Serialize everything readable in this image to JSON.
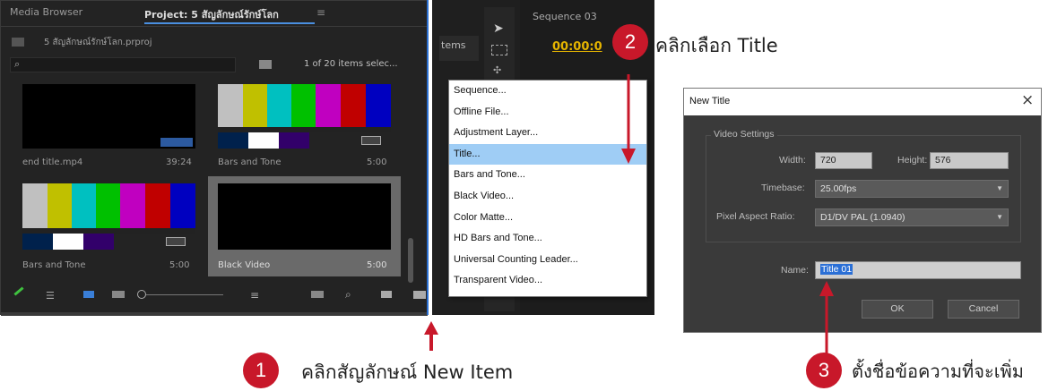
{
  "project_panel": {
    "tab_media_browser": "Media Browser",
    "tab_project": "Project: 5 สัญลักษณ์รักษ์โลก",
    "tab_menu_icon": "hamburger-icon",
    "project_file": "5 สัญลักษณ์รักษ์โลก.prproj",
    "search_icon": "search-icon",
    "items_status": "1 of 20 items selec...",
    "clips": [
      {
        "name": "end title.mp4",
        "duration": "39:24"
      },
      {
        "name": "Bars and Tone",
        "duration": "5:00"
      },
      {
        "name": "Bars and Tone",
        "duration": "5:00"
      },
      {
        "name": "Black Video",
        "duration": "5:00"
      }
    ]
  },
  "middle_panel": {
    "items_label": "tems",
    "sequence_tab": "Sequence 03",
    "timecode": "00:00:0"
  },
  "new_item_menu": {
    "items": [
      "Sequence...",
      "Offline File...",
      "Adjustment Layer...",
      "Title...",
      "Bars and Tone...",
      "Black Video...",
      "Color Matte...",
      "HD Bars and Tone...",
      "Universal Counting Leader...",
      "Transparent Video..."
    ],
    "selected": "Title..."
  },
  "dialog": {
    "title": "New Title",
    "close": "×",
    "group": "Video Settings",
    "width_label": "Width:",
    "width_value": "720",
    "height_label": "Height:",
    "height_value": "576",
    "timebase_label": "Timebase:",
    "timebase_value": "25.00fps",
    "par_label": "Pixel Aspect Ratio:",
    "par_value": "D1/DV PAL (1.0940)",
    "name_label": "Name:",
    "name_value": "Title 01",
    "ok": "OK",
    "cancel": "Cancel"
  },
  "callouts": [
    {
      "num": "1",
      "text": "คลิกสัญลักษณ์ New Item"
    },
    {
      "num": "2",
      "text": "คลิกเลือก Title"
    },
    {
      "num": "3",
      "text": "ตั้งชื่อข้อความที่จะเพิ่ม"
    }
  ],
  "colors": {
    "badge": "#c8182a",
    "arrow": "#c8182a",
    "menu_highlight": "#9fcdf5",
    "name_highlight": "#2a6fd6"
  }
}
